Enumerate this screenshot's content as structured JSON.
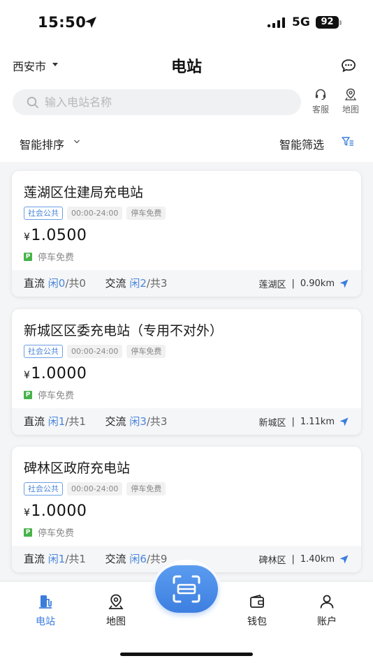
{
  "status_bar": {
    "time": "15:50",
    "network": "5G",
    "battery": "92"
  },
  "header": {
    "city": "西安市",
    "title": "电站",
    "search_placeholder": "输入电站名称",
    "service_label": "客服",
    "map_label": "地图",
    "sort_label": "智能排序",
    "filter_label": "智能筛选"
  },
  "stations": [
    {
      "name": "莲湖区住建局充电站",
      "tags": [
        "社会公共",
        "00:00-24:00",
        "停车免费"
      ],
      "currency": "¥",
      "price": "1.0500",
      "parking": "停车免费",
      "dc_label": "直流",
      "dc_free": "闲0",
      "dc_total": "/共0",
      "ac_label": "交流",
      "ac_free": "闲2",
      "ac_total": "/共3",
      "district": "莲湖区",
      "distance": "0.90km"
    },
    {
      "name": "新城区区委充电站（专用不对外）",
      "tags": [
        "社会公共",
        "00:00-24:00",
        "停车免费"
      ],
      "currency": "¥",
      "price": "1.0000",
      "parking": "停车免费",
      "dc_label": "直流",
      "dc_free": "闲1",
      "dc_total": "/共1",
      "ac_label": "交流",
      "ac_free": "闲3",
      "ac_total": "/共3",
      "district": "新城区",
      "distance": "1.11km"
    },
    {
      "name": "碑林区政府充电站",
      "tags": [
        "社会公共",
        "00:00-24:00",
        "停车免费"
      ],
      "currency": "¥",
      "price": "1.0000",
      "parking": "停车免费",
      "dc_label": "直流",
      "dc_free": "闲1",
      "dc_total": "/共1",
      "ac_label": "交流",
      "ac_free": "闲6",
      "ac_total": "/共9",
      "district": "碑林区",
      "distance": "1.40km"
    }
  ],
  "tabbar": {
    "tabs": [
      {
        "label": "电站",
        "icon": "station-icon",
        "active": true
      },
      {
        "label": "地图",
        "icon": "map-pin-icon",
        "active": false
      },
      {
        "label": "钱包",
        "icon": "wallet-icon",
        "active": false
      },
      {
        "label": "账户",
        "icon": "user-icon",
        "active": false
      }
    ],
    "scan_icon": "scan-icon"
  },
  "colors": {
    "accent": "#3b7ddd",
    "parking_green": "#47b34a"
  }
}
